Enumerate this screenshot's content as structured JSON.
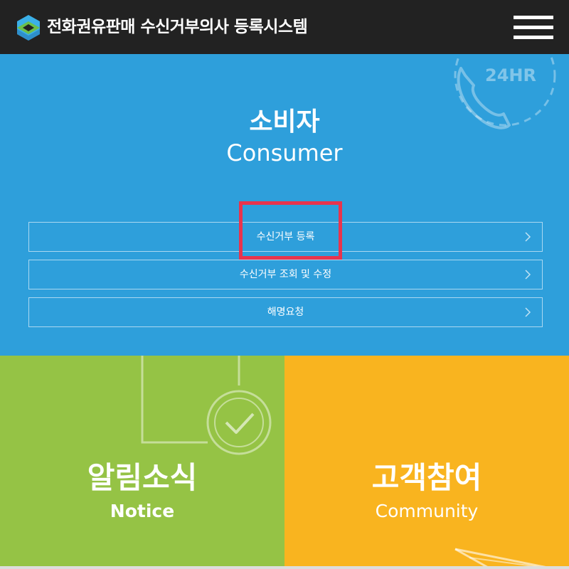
{
  "header": {
    "title": "전화권유판매 수신거부의사 등록시스템",
    "menu_icon": "hamburger-menu-icon"
  },
  "consumer": {
    "title": "소비자",
    "subtitle": "Consumer",
    "decoration": {
      "icon": "phone-24hr-icon",
      "text": "24HR"
    },
    "items": [
      {
        "label": "수신거부 등록",
        "icon": "chevron-right-icon"
      },
      {
        "label": "수신거부 조회 및 수정",
        "icon": "chevron-right-icon"
      },
      {
        "label": "해명요청",
        "icon": "chevron-right-icon"
      }
    ]
  },
  "notice": {
    "title": "알림소식",
    "subtitle": "Notice",
    "icon": "checkmark-circle-icon"
  },
  "community": {
    "title": "고객참여",
    "subtitle": "Community",
    "icon": "paper-plane-icon"
  },
  "colors": {
    "header_bg": "#222222",
    "consumer_bg": "#2e9fdb",
    "notice_bg": "#95c345",
    "community_bg": "#f9b41f",
    "highlight": "#e8344d"
  }
}
